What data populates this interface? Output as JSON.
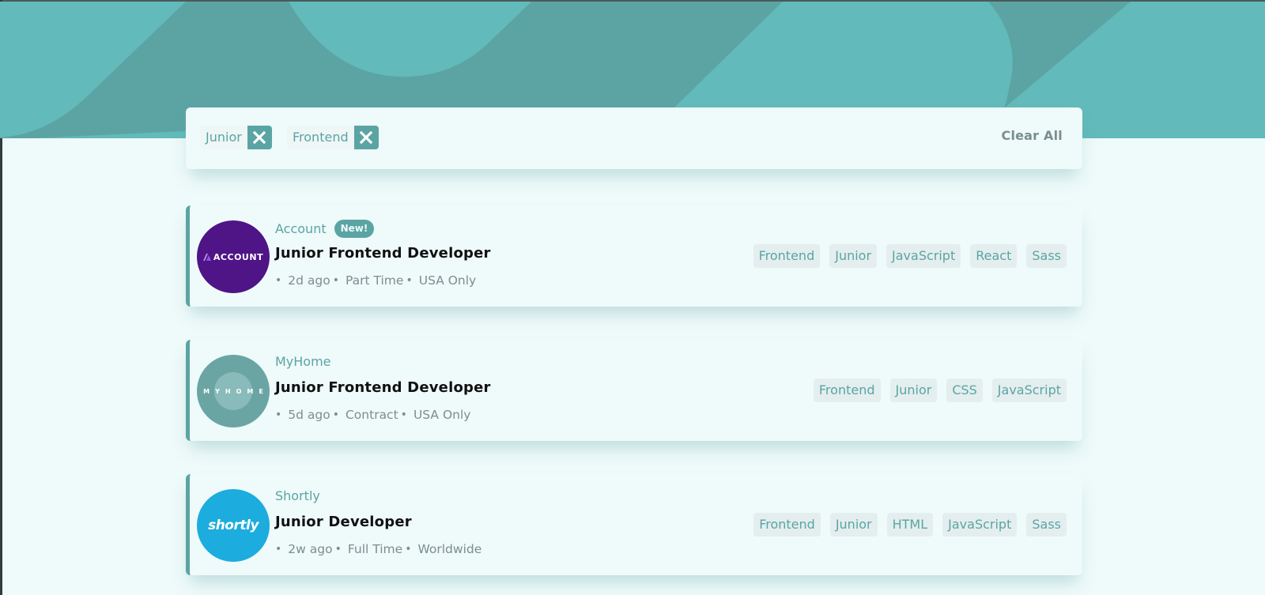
{
  "filters": {
    "chips": [
      {
        "label": "Junior",
        "remove_icon": "close-icon"
      },
      {
        "label": "Frontend",
        "remove_icon": "close-icon"
      }
    ],
    "clear_label": "Clear All"
  },
  "jobs": [
    {
      "company": "Account",
      "logo_text": "ACCOUNT",
      "badge": "New!",
      "position": "Junior Frontend Developer",
      "posted": "2d ago",
      "contract": "Part Time",
      "location": "USA Only",
      "tags": [
        "Frontend",
        "Junior",
        "JavaScript",
        "React",
        "Sass"
      ]
    },
    {
      "company": "MyHome",
      "logo_text": "MYHOME",
      "position": "Junior Frontend Developer",
      "posted": "5d ago",
      "contract": "Contract",
      "location": "USA Only",
      "tags": [
        "Frontend",
        "Junior",
        "CSS",
        "JavaScript"
      ]
    },
    {
      "company": "Shortly",
      "logo_text": "shortly",
      "position": "Junior Developer",
      "posted": "2w ago",
      "contract": "Full Time",
      "location": "Worldwide",
      "tags": [
        "Frontend",
        "Junior",
        "HTML",
        "JavaScript",
        "Sass"
      ]
    }
  ],
  "colors": {
    "primary": "#5ba4a4",
    "background": "#effafa",
    "tag_background": "#e4eeee",
    "text_muted": "#7b8e8e"
  }
}
